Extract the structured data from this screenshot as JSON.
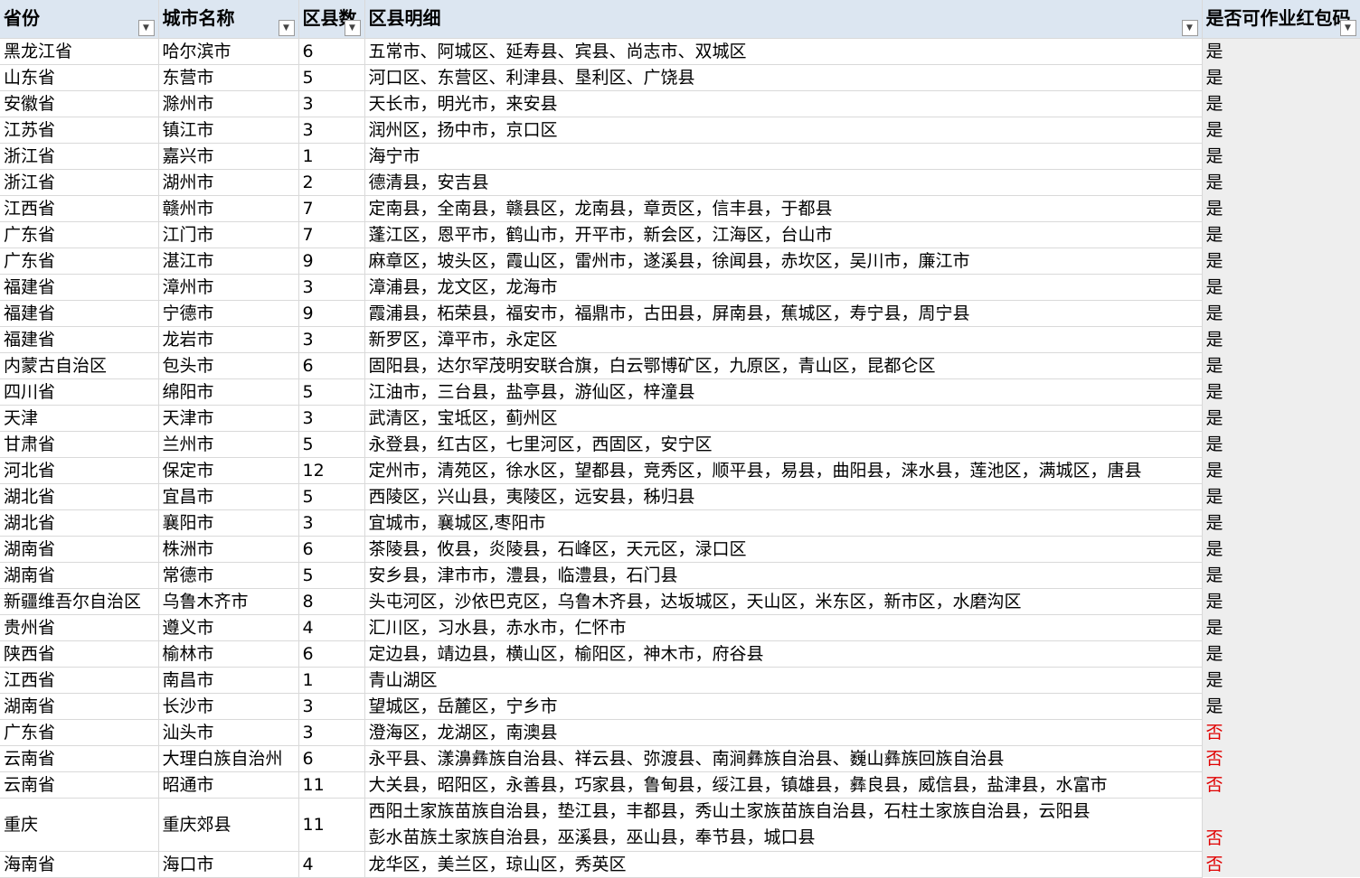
{
  "headers": {
    "province": "省份",
    "city": "城市名称",
    "count": "区县数",
    "details": "区县明细",
    "can_work": "是否可作业红包码"
  },
  "filter_icon": "filter-dropdown-icon",
  "colors": {
    "header_bg": "#dce6f1",
    "no_text": "#e00000",
    "last_col_bg": "#eeeeee"
  },
  "rows": [
    {
      "province": "黑龙江省",
      "city": "哈尔滨市",
      "count": "6",
      "details": "五常市、阿城区、延寿县、宾县、尚志市、双城区",
      "can_work": "是"
    },
    {
      "province": "山东省",
      "city": "东营市",
      "count": "5",
      "details": "河口区、东营区、利津县、垦利区、广饶县",
      "can_work": "是"
    },
    {
      "province": "安徽省",
      "city": "滁州市",
      "count": "3",
      "details": "天长市，明光市，来安县",
      "can_work": "是"
    },
    {
      "province": "江苏省",
      "city": "镇江市",
      "count": "3",
      "details": "润州区，扬中市，京口区",
      "can_work": "是"
    },
    {
      "province": "浙江省",
      "city": "嘉兴市",
      "count": "1",
      "details": "海宁市",
      "can_work": "是"
    },
    {
      "province": "浙江省",
      "city": "湖州市",
      "count": "2",
      "details": "德清县，安吉县",
      "can_work": "是"
    },
    {
      "province": "江西省",
      "city": "赣州市",
      "count": "7",
      "details": "定南县，全南县，赣县区，龙南县，章贡区，信丰县，于都县",
      "can_work": "是"
    },
    {
      "province": "广东省",
      "city": "江门市",
      "count": "7",
      "details": "蓬江区，恩平市，鹤山市，开平市，新会区，江海区，台山市",
      "can_work": "是"
    },
    {
      "province": "广东省",
      "city": "湛江市",
      "count": "9",
      "details": "麻章区，坡头区，霞山区，雷州市，遂溪县，徐闻县，赤坎区，吴川市，廉江市",
      "can_work": "是"
    },
    {
      "province": "福建省",
      "city": "漳州市",
      "count": "3",
      "details": "漳浦县，龙文区，龙海市",
      "can_work": "是"
    },
    {
      "province": "福建省",
      "city": "宁德市",
      "count": "9",
      "details": "霞浦县，柘荣县，福安市，福鼎市，古田县，屏南县，蕉城区，寿宁县，周宁县",
      "can_work": "是"
    },
    {
      "province": "福建省",
      "city": "龙岩市",
      "count": "3",
      "details": "新罗区，漳平市，永定区",
      "can_work": "是"
    },
    {
      "province": "内蒙古自治区",
      "city": "包头市",
      "count": "6",
      "details": "固阳县，达尔罕茂明安联合旗，白云鄂博矿区，九原区，青山区，昆都仑区",
      "can_work": "是"
    },
    {
      "province": "四川省",
      "city": "绵阳市",
      "count": "5",
      "details": "江油市，三台县，盐亭县，游仙区，梓潼县",
      "can_work": "是"
    },
    {
      "province": "天津",
      "city": "天津市",
      "count": "3",
      "details": "武清区，宝坻区，蓟州区",
      "can_work": "是"
    },
    {
      "province": "甘肃省",
      "city": "兰州市",
      "count": "5",
      "details": "永登县，红古区，七里河区，西固区，安宁区",
      "can_work": "是"
    },
    {
      "province": "河北省",
      "city": "保定市",
      "count": "12",
      "details": "定州市，清苑区，徐水区，望都县，竞秀区，顺平县，易县，曲阳县，涞水县，莲池区，满城区，唐县",
      "can_work": "是"
    },
    {
      "province": "湖北省",
      "city": "宜昌市",
      "count": "5",
      "details": "西陵区，兴山县，夷陵区，远安县，秭归县",
      "can_work": "是"
    },
    {
      "province": "湖北省",
      "city": "襄阳市",
      "count": "3",
      "details": "宜城市，襄城区,枣阳市",
      "can_work": "是"
    },
    {
      "province": "湖南省",
      "city": "株洲市",
      "count": "6",
      "details": "茶陵县，攸县，炎陵县，石峰区，天元区，渌口区",
      "can_work": "是"
    },
    {
      "province": "湖南省",
      "city": "常德市",
      "count": "5",
      "details": "安乡县，津市市，澧县，临澧县，石门县",
      "can_work": "是"
    },
    {
      "province": "新疆维吾尔自治区",
      "city": "乌鲁木齐市",
      "count": "8",
      "details": "头屯河区，沙依巴克区，乌鲁木齐县，达坂城区，天山区，米东区，新市区，水磨沟区",
      "can_work": "是"
    },
    {
      "province": "贵州省",
      "city": "遵义市",
      "count": "4",
      "details": "汇川区，习水县，赤水市，仁怀市",
      "can_work": "是"
    },
    {
      "province": "陕西省",
      "city": "榆林市",
      "count": "6",
      "details": "定边县，靖边县，横山区，榆阳区，神木市，府谷县",
      "can_work": "是"
    },
    {
      "province": "江西省",
      "city": "南昌市",
      "count": "1",
      "details": "青山湖区",
      "can_work": "是"
    },
    {
      "province": "湖南省",
      "city": "长沙市",
      "count": "3",
      "details": "望城区，岳麓区，宁乡市",
      "can_work": "是"
    },
    {
      "province": "广东省",
      "city": "汕头市",
      "count": "3",
      "details": "澄海区，龙湖区，南澳县",
      "can_work": "否"
    },
    {
      "province": "云南省",
      "city": "大理白族自治州",
      "count": "6",
      "details": "永平县、漾濞彝族自治县、祥云县、弥渡县、南涧彝族自治县、巍山彝族回族自治县",
      "can_work": "否"
    },
    {
      "province": "云南省",
      "city": "昭通市",
      "count": "11",
      "details": "大关县，昭阳区，永善县，巧家县，鲁甸县，绥江县，镇雄县，彝良县，威信县，盐津县，水富市",
      "can_work": "否"
    },
    {
      "province": "重庆",
      "city": "重庆郊县",
      "count": "11",
      "details": "西阳土家族苗族自治县，垫江县，丰都县，秀山土家族苗族自治县，石柱土家族自治县，云阳县",
      "details2": "彭水苗族土家族自治县，巫溪县，巫山县，奉节县，城口县",
      "can_work": "否"
    },
    {
      "province": "海南省",
      "city": "海口市",
      "count": "4",
      "details": "龙华区，美兰区，琼山区，秀英区",
      "can_work": "否"
    }
  ]
}
